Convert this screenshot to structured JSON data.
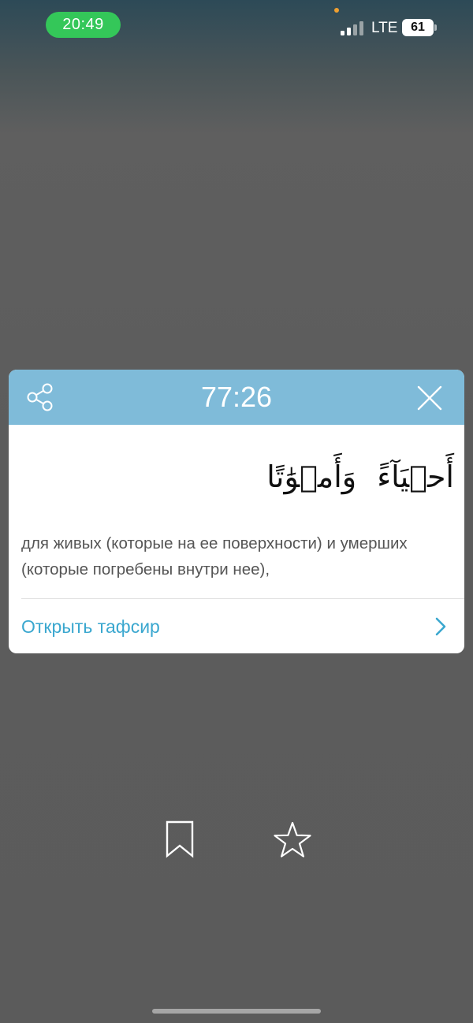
{
  "status_bar": {
    "time": "20:49",
    "network": "LTE",
    "battery": "61",
    "signal_icon": "cellular-signal-icon"
  },
  "ayah_card": {
    "header_color": "#7fbbd9",
    "reference": "77:26",
    "share_icon": "share-icon",
    "close_icon": "close-icon",
    "arabic_text": "أَحۡيَآءً وَأَمۡوَٰتًا",
    "translation": "для живых (которые на ее поверхности) и умерших (которые погребены внутри нее),",
    "open_tafsir_label": "Открыть тафсир",
    "open_tafsir_icon": "chevron-right-icon",
    "link_color": "#3aa7cf"
  },
  "actions": {
    "bookmark_icon": "bookmark-icon",
    "favorite_icon": "star-icon"
  }
}
